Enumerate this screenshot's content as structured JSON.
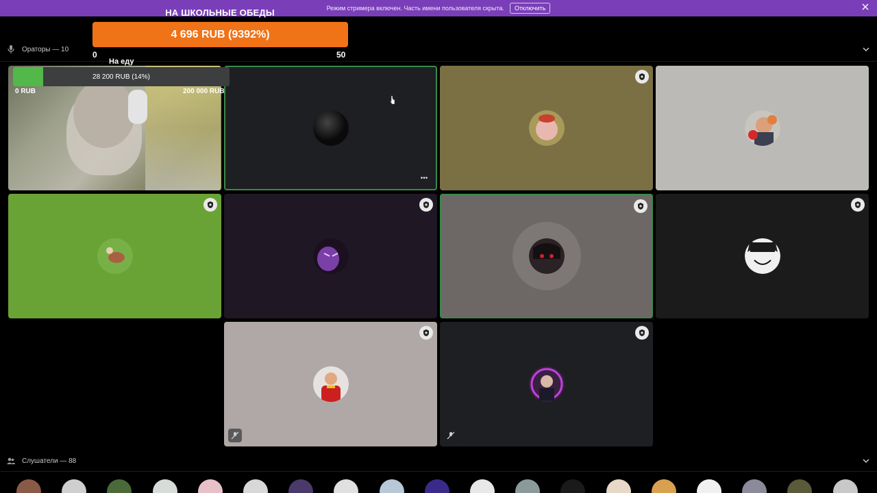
{
  "banner": {
    "notice": "Режим стримера включен. Часть имени пользователя скрыта.",
    "disable_label": "Отключить",
    "close_icon": "close-icon"
  },
  "donation": {
    "title": "НА ШКОЛЬНЫЕ ОБЕДЫ",
    "amount": "4 696 RUB (9392%)",
    "min": "0",
    "max": "50"
  },
  "speakers": {
    "label": "Ораторы — 10"
  },
  "goal": {
    "label": "На еду",
    "amount": "28 200 RUB (14%)",
    "min": "0 RUB",
    "max": "200 000 RUB",
    "progress": 0.14
  },
  "tiles": [
    {
      "name": "webcam",
      "shield": false,
      "speaking": false
    },
    {
      "name": "dark-orb",
      "shield": false,
      "speaking": true
    },
    {
      "name": "pig-avatar",
      "shield": true,
      "speaking": false
    },
    {
      "name": "smiling-man",
      "shield": false,
      "speaking": false
    },
    {
      "name": "creature",
      "shield": true,
      "speaking": false
    },
    {
      "name": "purple-ghost",
      "shield": true,
      "speaking": false
    },
    {
      "name": "anime-face",
      "shield": true,
      "speaking": true
    },
    {
      "name": "cat-ears",
      "shield": true,
      "speaking": false
    },
    {
      "name": "red-shirt",
      "shield": true,
      "speaking": false
    },
    {
      "name": "neon-man",
      "shield": true,
      "speaking": false
    }
  ],
  "listeners": {
    "label": "Слушатели — 88",
    "count_visible": 19
  },
  "colors": {
    "banner": "#7a3fb8",
    "donation_bar": "#f07318",
    "goal_fill": "#52b849"
  }
}
